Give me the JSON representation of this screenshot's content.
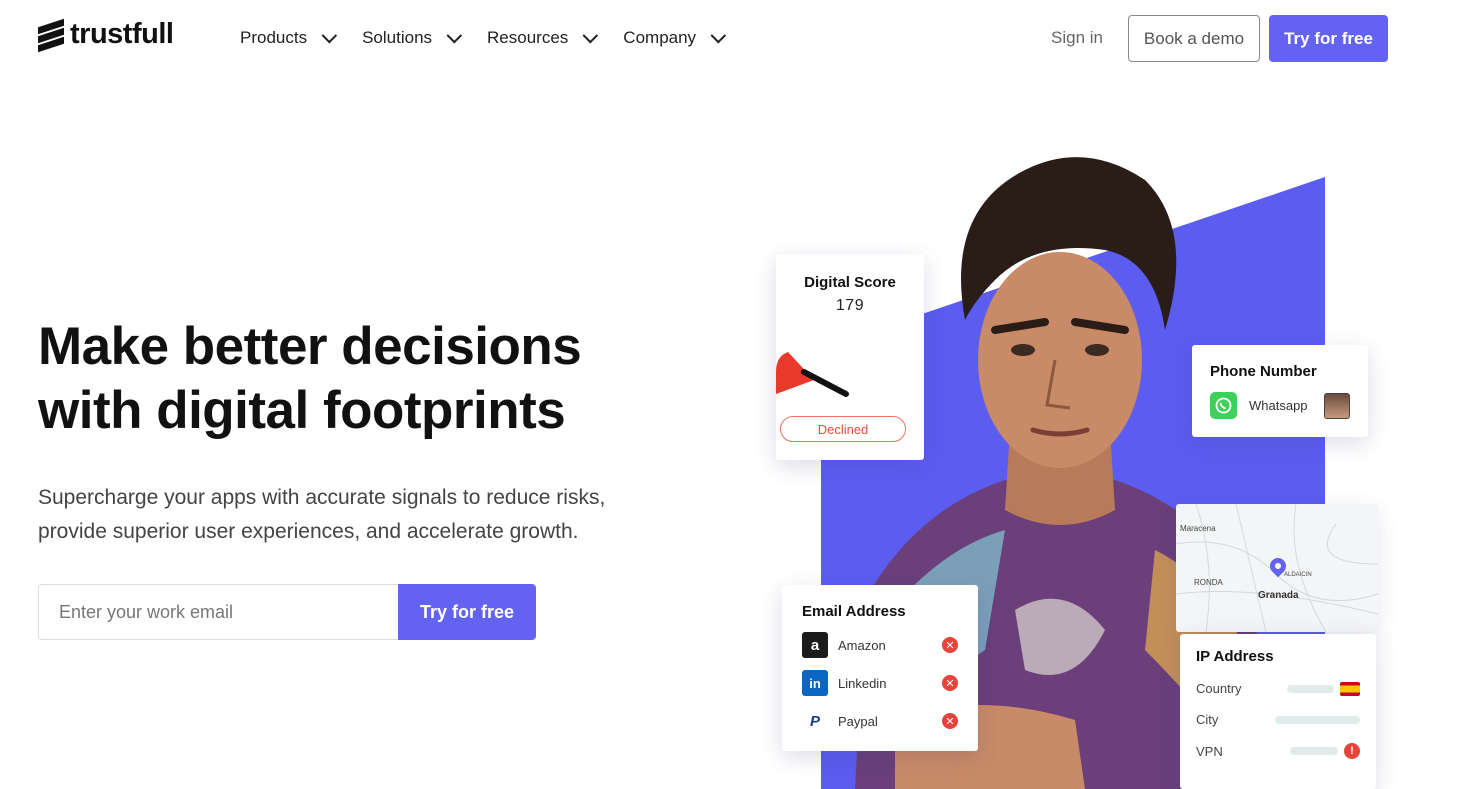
{
  "brand": {
    "name": "trustfull"
  },
  "nav": {
    "items": [
      {
        "label": "Products"
      },
      {
        "label": "Solutions"
      },
      {
        "label": "Resources"
      },
      {
        "label": "Company"
      }
    ],
    "sign_in": "Sign in",
    "book_demo": "Book a demo",
    "try_free": "Try for free"
  },
  "hero": {
    "title_line1": "Make better decisions",
    "title_line2": "with digital footprints",
    "subtitle_line1": "Supercharge your apps with accurate signals to reduce risks,",
    "subtitle_line2": "provide superior user experiences, and accelerate growth.",
    "email_placeholder": "Enter your work email",
    "cta": "Try for free"
  },
  "cards": {
    "digital_score": {
      "title": "Digital Score",
      "value": "179",
      "status": "Declined",
      "gauge_level": 0.15
    },
    "phone": {
      "title": "Phone Number",
      "channel": "Whatsapp"
    },
    "email": {
      "title": "Email Address",
      "accounts": [
        {
          "name": "Amazon",
          "icon": "amazon-icon",
          "status": "x"
        },
        {
          "name": "Linkedin",
          "icon": "linkedin-icon",
          "status": "x"
        },
        {
          "name": "Paypal",
          "icon": "paypal-icon",
          "status": "x"
        }
      ]
    },
    "map": {
      "labels": [
        "Maracena",
        "RONDA",
        "ALDAICIN",
        "Granada"
      ]
    },
    "ip": {
      "title": "IP Address",
      "rows": [
        {
          "key": "Country",
          "indicator": "spain-flag"
        },
        {
          "key": "City",
          "indicator": ""
        },
        {
          "key": "VPN",
          "indicator": "!"
        }
      ]
    }
  },
  "colors": {
    "accent": "#6463f1",
    "purple_bg": "#5b5cf0",
    "danger": "#e8433a"
  }
}
